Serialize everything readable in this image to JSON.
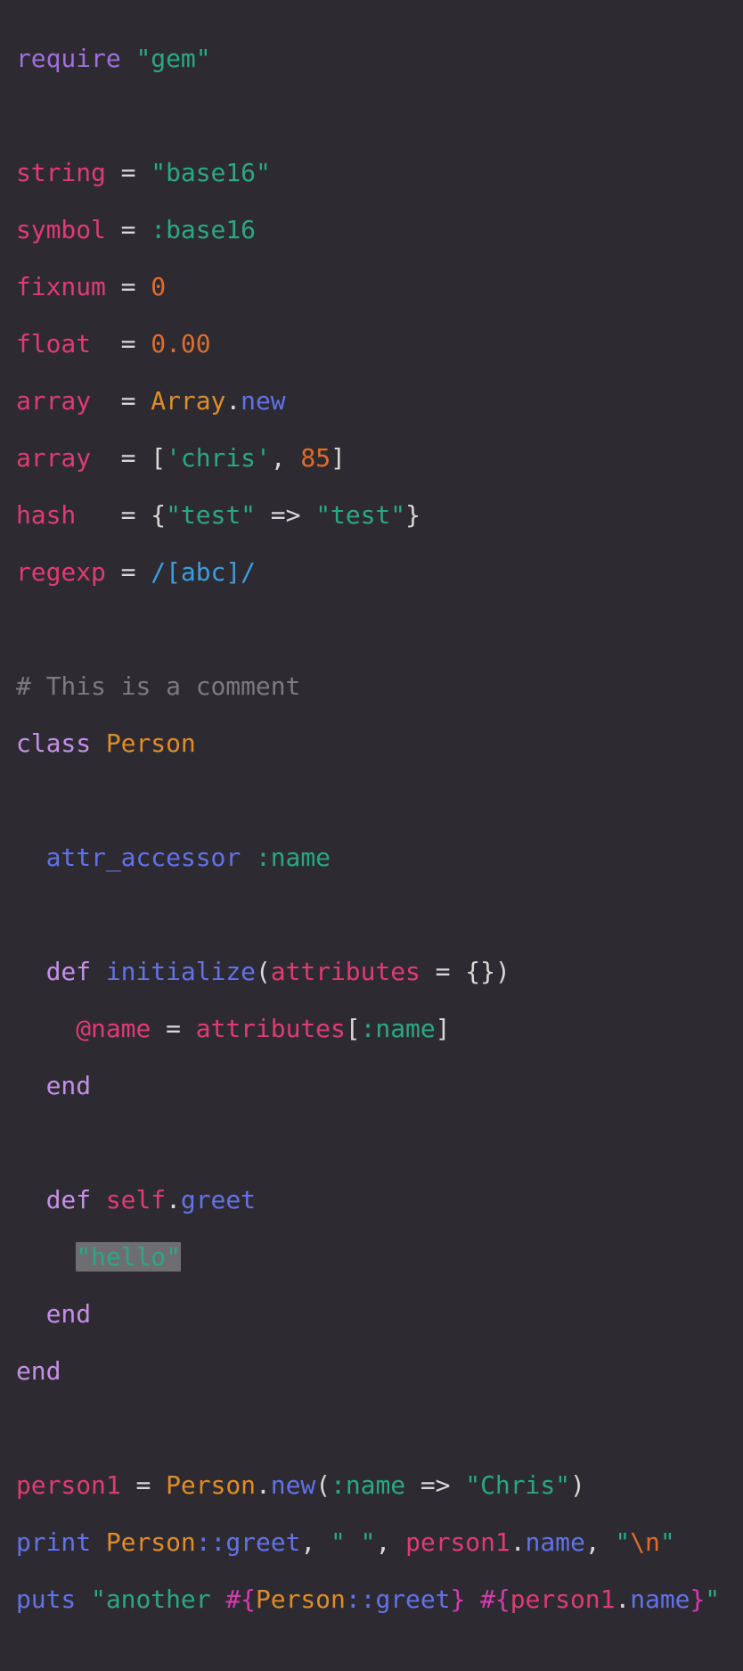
{
  "editor": {
    "language": "ruby",
    "background_color": "#2d2b31",
    "default_text_color": "#d8d8d8",
    "font_size_px": 28,
    "line_height_px": 32,
    "selection": {
      "text": "\"hello\"",
      "background_color": "#6e6e72",
      "line_number": 22
    },
    "palette": {
      "keyword": "#a06ee0",
      "keyword_light": "#c58fe8",
      "variable": "#e03b73",
      "string": "#2aa882",
      "number": "#e06c2b",
      "constant": "#e08c27",
      "function": "#6272e8",
      "punctuation": "#d8d8d8",
      "comment": "#7c7a80",
      "regexp": "#3a9fe0",
      "interpolation": "#d63bb0"
    }
  },
  "code": {
    "line_1_require": "require",
    "line_1_gem": "\"gem\"",
    "line_3_name": "string",
    "line_3_eq": "=",
    "line_3_value": "\"base16\"",
    "line_4_name": "symbol",
    "line_4_eq": "=",
    "line_4_value": ":base16",
    "line_5_name": "fixnum",
    "line_5_eq": "=",
    "line_5_value": "0",
    "line_6_name": "float",
    "line_6_eq": "=",
    "line_6_value": "0.00",
    "line_7_name": "array",
    "line_7_eq": "=",
    "line_7_const": "Array",
    "line_7_dot": ".",
    "line_7_method": "new",
    "line_8_name": "array",
    "line_8_eq": "=",
    "line_8_open": "[",
    "line_8_str": "'chris'",
    "line_8_comma": ", ",
    "line_8_num": "85",
    "line_8_close": "]",
    "line_9_name": "hash",
    "line_9_eq": "=",
    "line_9_open": "{",
    "line_9_key": "\"test\"",
    "line_9_arrow": " => ",
    "line_9_val": "\"test\"",
    "line_9_close": "}",
    "line_10_name": "regexp",
    "line_10_eq": "=",
    "line_10_value": "/[abc]/",
    "line_12_comment": "# This is a comment",
    "line_13_kw": "class",
    "line_13_const": "Person",
    "line_15_fn": "attr_accessor",
    "line_15_symbol": ":name",
    "line_17_def": "def",
    "line_17_name": "initialize",
    "line_17_open": "(",
    "line_17_param": "attributes",
    "line_17_eq": " = ",
    "line_17_hash": "{}",
    "line_17_close": ")",
    "line_18_ivar": "@name",
    "line_18_eq": "=",
    "line_18_var": "attributes",
    "line_18_open": "[",
    "line_18_symbol": ":name",
    "line_18_close": "]",
    "line_19_end": "end",
    "line_21_def": "def",
    "line_21_self": "self",
    "line_21_dot": ".",
    "line_21_method": "greet",
    "line_22_str": "\"hello\"",
    "line_23_end": "end",
    "line_24_end": "end",
    "line_26_var": "person1",
    "line_26_eq": "=",
    "line_26_const": "Person",
    "line_26_dot": ".",
    "line_26_method": "new",
    "line_26_open": "(",
    "line_26_symbol": ":name",
    "line_26_arrow": " => ",
    "line_26_str": "\"Chris\"",
    "line_26_close": ")",
    "line_27_print": "print",
    "line_27_const": "Person",
    "line_27_scope": "::",
    "line_27_method": "greet",
    "line_27_comma1": ", ",
    "line_27_space_str": "\" \"",
    "line_27_comma2": ", ",
    "line_27_var": "person1",
    "line_27_dot": ".",
    "line_27_attr": "name",
    "line_27_comma3": ", ",
    "line_27_quote_open": "\"",
    "line_27_escape": "\\n",
    "line_27_quote_close": "\"",
    "line_28_puts": "puts",
    "line_28_quote_open": "\"",
    "line_28_text": "another ",
    "line_28_interp_open1": "#{",
    "line_28_const": "Person",
    "line_28_scope": "::",
    "line_28_method": "greet",
    "line_28_interp_close1": "}",
    "line_28_space": " ",
    "line_28_interp_open2": "#{",
    "line_28_var": "person1",
    "line_28_dot": ".",
    "line_28_attr": "name",
    "line_28_interp_close2": "}",
    "line_28_quote_close": "\""
  }
}
